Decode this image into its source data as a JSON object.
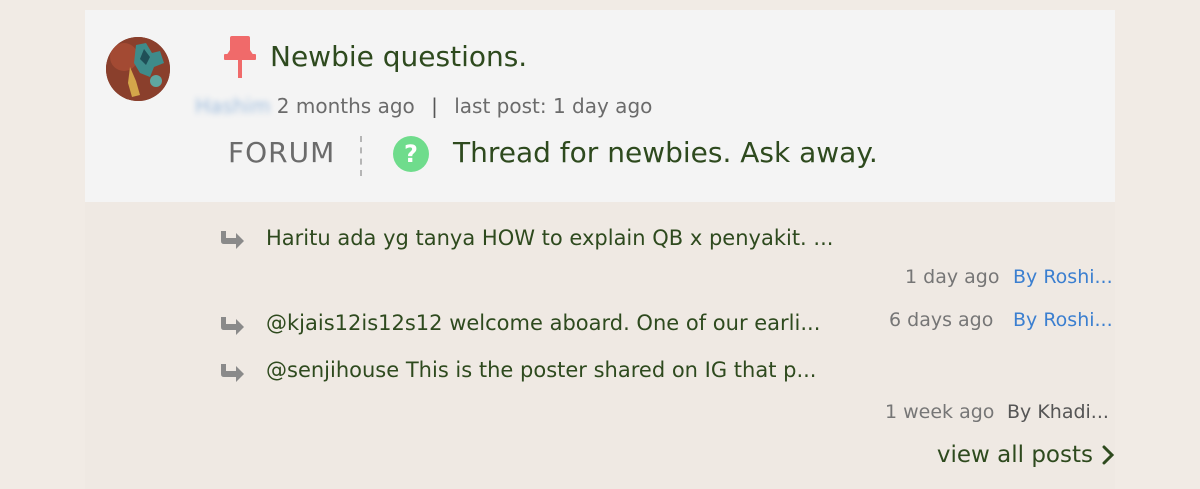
{
  "thread": {
    "title": "Newbie questions.",
    "author": "Hashim",
    "created": "2 months ago",
    "separator": "|",
    "last_post": "last post: 1 day ago",
    "forum_label": "FORUM",
    "forum_description": "Thread for newbies. Ask away."
  },
  "posts": [
    {
      "text": "Haritu ada yg tanya HOW to explain QB x penyakit. ...",
      "time": "1 day ago",
      "by": "By Roshi..."
    },
    {
      "text": "@kjais12is12s12 welcome aboard. One of our earli...",
      "time": "6 days ago",
      "by": "By Roshi..."
    },
    {
      "text": "@senjihouse This is the poster shared on IG that p...",
      "time": "1 week ago",
      "by": "By Khadi..."
    }
  ],
  "footer": {
    "view_all": "view all posts"
  },
  "colors": {
    "title_green": "#2e4a1e",
    "link_blue": "#3b7fd0",
    "pin_red": "#f06a6a",
    "help_green": "#6fdc8c"
  },
  "icons": [
    "pushpin-icon",
    "help-icon",
    "reply-arrow-icon",
    "chevron-right-icon"
  ]
}
